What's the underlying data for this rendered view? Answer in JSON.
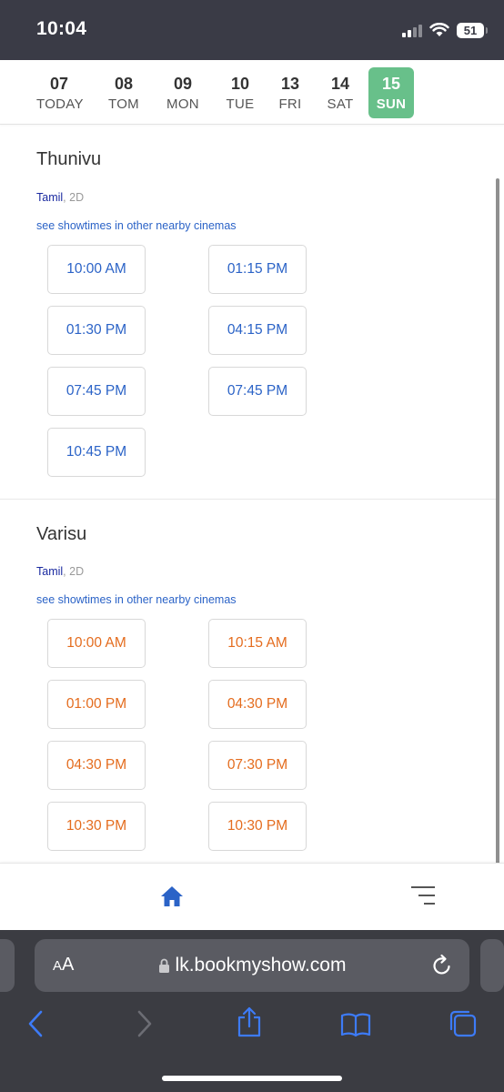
{
  "status": {
    "time": "10:04",
    "battery": "51"
  },
  "dates": [
    {
      "num": "07",
      "day": "TODAY",
      "active": false
    },
    {
      "num": "08",
      "day": "TOM",
      "active": false
    },
    {
      "num": "09",
      "day": "MON",
      "active": false
    },
    {
      "num": "10",
      "day": "TUE",
      "active": false
    },
    {
      "num": "13",
      "day": "FRI",
      "active": false
    },
    {
      "num": "14",
      "day": "SAT",
      "active": false
    },
    {
      "num": "15",
      "day": "SUN",
      "active": true
    }
  ],
  "movies": [
    {
      "title": "Thunivu",
      "language": "Tamil",
      "format": ", 2D",
      "link": "see showtimes in other nearby cinemas",
      "showtimes": [
        "10:00 AM",
        "01:15 PM",
        "01:30 PM",
        "04:15 PM",
        "07:45 PM",
        "07:45 PM",
        "10:45 PM"
      ]
    },
    {
      "title": "Varisu",
      "language": "Tamil",
      "format": ", 2D",
      "link": "see showtimes in other nearby cinemas",
      "showtimes": [
        "10:00 AM",
        "10:15 AM",
        "01:00 PM",
        "04:30 PM",
        "04:30 PM",
        "07:30 PM",
        "10:30 PM",
        "10:30 PM"
      ]
    }
  ],
  "bottom_nav": {
    "home_icon": "home-icon",
    "menu_icon": "menu-icon"
  },
  "safari": {
    "aa_large": "A",
    "aa_small": "A",
    "url": "lk.bookmyshow.com"
  },
  "colors": {
    "active_date": "#68c08a",
    "thunivu_time": "#2b63c7",
    "varisu_time": "#e46c1e",
    "link": "#2b63c7",
    "nav_home": "#2b63c7"
  }
}
